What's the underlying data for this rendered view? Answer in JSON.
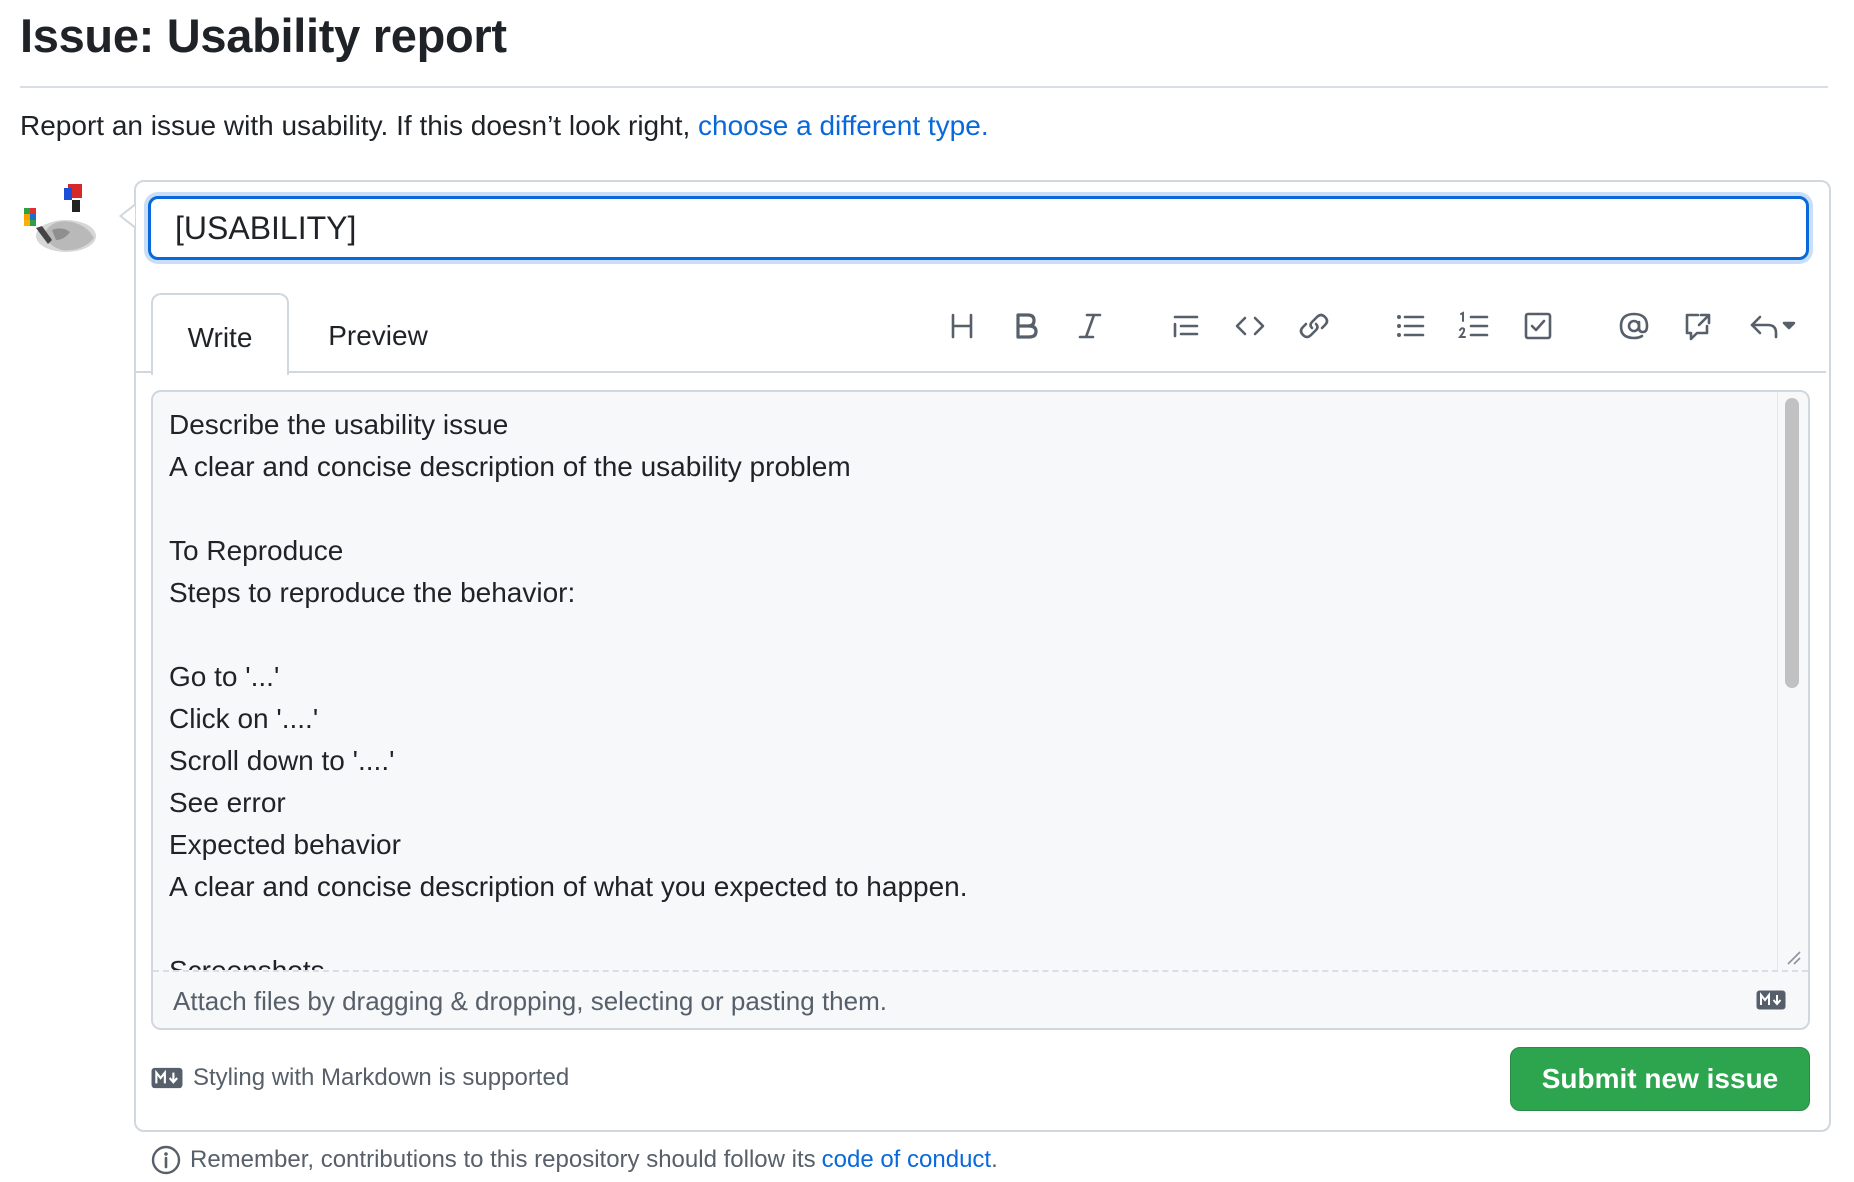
{
  "page": {
    "title": "Issue: Usability report",
    "intro_text": "Report an issue with usability. If this doesn’t look right,",
    "intro_link": "choose a different type."
  },
  "form": {
    "title_value": "[USABILITY]",
    "tabs": [
      {
        "label": "Write",
        "active": true
      },
      {
        "label": "Preview",
        "active": false
      }
    ],
    "toolbar_icons": [
      "heading-icon",
      "bold-icon",
      "italic-icon",
      "quote-icon",
      "code-icon",
      "link-icon",
      "bulleted-list-icon",
      "numbered-list-icon",
      "task-list-icon",
      "mention-icon",
      "reference-icon",
      "reply-icon"
    ],
    "body_lines": [
      "Describe the usability issue",
      "A clear and concise description of the usability problem",
      "",
      "To Reproduce",
      "Steps to reproduce the behavior:",
      "",
      "Go to '...'",
      "Click on '....'",
      "Scroll down to '....'",
      "See error",
      "Expected behavior",
      "A clear and concise description of what you expected to happen.",
      "",
      "Screenshots"
    ],
    "attach_text": "Attach files by dragging & dropping, selecting or pasting them.",
    "markdown_note": "Styling with Markdown is supported",
    "submit_label": "Submit new issue"
  },
  "footer": {
    "remember_text": "Remember, contributions to this repository should follow its",
    "conduct_link": "code of conduct",
    "period": "."
  },
  "colors": {
    "accent": "#0969da",
    "submit": "#2da44e",
    "border": "#d0d7de"
  }
}
